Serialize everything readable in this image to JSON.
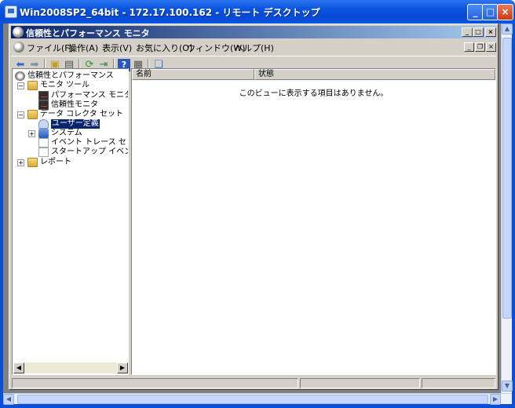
{
  "rdp": {
    "title": "Win2008SP2_64bit - 172.17.100.162 - リモート デスクトップ"
  },
  "mmc": {
    "title": "信頼性とパフォーマンス モニタ"
  },
  "menu": {
    "items": [
      "ファイル(F)",
      "操作(A)",
      "表示(V)",
      "お気に入り(O)",
      "ウィンドウ(W)",
      "ヘルプ(H)"
    ]
  },
  "toolbar": {
    "icons": [
      "back-icon",
      "forward-icon",
      "up-folder-icon",
      "show-hide-tree-icon",
      "refresh-icon",
      "export-list-icon",
      "help-icon",
      "properties-icon",
      "new-window-icon"
    ]
  },
  "tree": {
    "root": "信頼性とパフォーマンス",
    "monitor_tools": "モニタ ツール",
    "performance_monitor": "パフォーマンス モニタ",
    "reliability_monitor": "信頼性モニタ",
    "data_collector_sets": "データ コレクタ セット",
    "user_defined": "ユーザー定義",
    "system": "システム",
    "event_trace_sessions": "イベント トレース セッション",
    "startup_event_trace": "スタートアップ イベント トレ",
    "reports": "レポート"
  },
  "list": {
    "col_name": "名前",
    "col_status": "状態",
    "empty_message": "このビューに表示する項目はありません。"
  }
}
